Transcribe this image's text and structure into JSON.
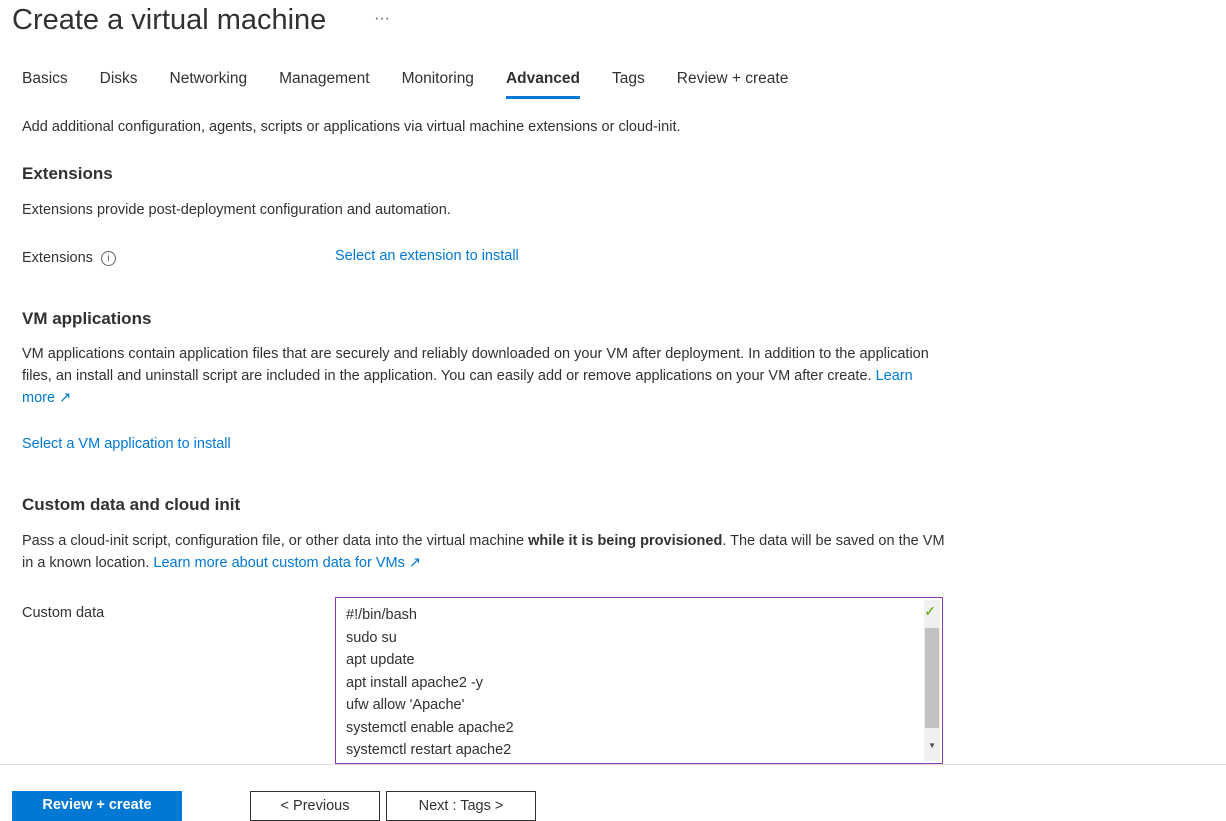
{
  "header": {
    "title": "Create a virtual machine",
    "more": "···"
  },
  "tabs": [
    "Basics",
    "Disks",
    "Networking",
    "Management",
    "Monitoring",
    "Advanced",
    "Tags",
    "Review + create"
  ],
  "active_tab": "Advanced",
  "intro": "Add additional configuration, agents, scripts or applications via virtual machine extensions or cloud-init.",
  "extensions": {
    "heading": "Extensions",
    "desc": "Extensions provide post-deployment configuration and automation.",
    "label": "Extensions",
    "link": "Select an extension to install"
  },
  "vm_apps": {
    "heading": "VM applications",
    "desc": "VM applications contain application files that are securely and reliably downloaded on your VM after deployment. In addition to the application files, an install and uninstall script are included in the application. You can easily add or remove applications on your VM after create.",
    "learn_more": "Learn more",
    "link": "Select a VM application to install"
  },
  "custom": {
    "heading": "Custom data and cloud init",
    "desc1": "Pass a cloud-init script, configuration file, or other data into the virtual machine ",
    "desc_bold": "while it is being provisioned",
    "desc2": ". The data will be saved on the VM in a known location. ",
    "learn_more": "Learn more about custom data for VMs",
    "label": "Custom data",
    "lines": [
      "#!/bin/bash",
      "sudo su",
      "apt update",
      "apt install apache2 -y",
      "ufw allow 'Apache'",
      "systemctl enable apache2",
      "systemctl restart apache2"
    ]
  },
  "footer": {
    "review": "Review + create",
    "previous": "< Previous",
    "next": "Next : Tags >"
  }
}
